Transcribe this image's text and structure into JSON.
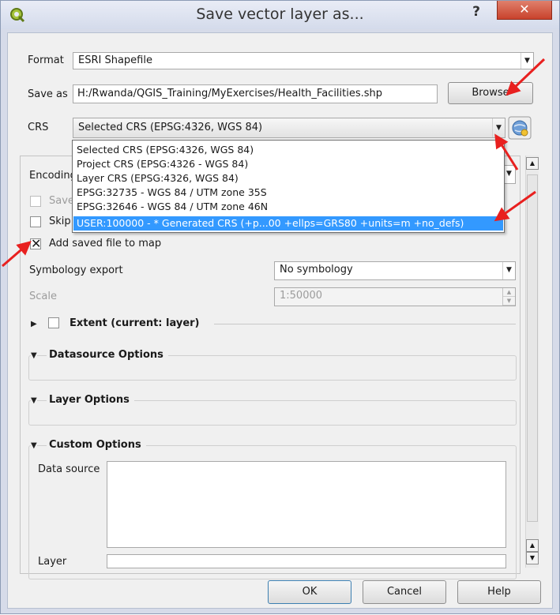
{
  "window": {
    "title": "Save vector layer as...",
    "help_label": "?",
    "close_label": "✕"
  },
  "form": {
    "format_label": "Format",
    "format_value": "ESRI Shapefile",
    "saveas_label": "Save as",
    "saveas_value": "H:/Rwanda/QGIS_Training/MyExercises/Health_Facilities.shp",
    "browse_label": "Browse",
    "crs_label": "CRS",
    "crs_value": "Selected CRS (EPSG:4326, WGS 84)"
  },
  "crs_options": [
    "Selected CRS (EPSG:4326, WGS 84)",
    "Project CRS (EPSG:4326 - WGS 84)",
    "Layer CRS (EPSG:4326, WGS 84)",
    "EPSG:32735 - WGS 84 / UTM zone 35S",
    "EPSG:32646 - WGS 84 / UTM zone 46N",
    "USER:100000 -  * Generated CRS (+p...00 +ellps=GRS80 +units=m +no_defs)"
  ],
  "options": {
    "encoding_label": "Encoding",
    "save_only_label": "Save",
    "skip_label": "Skip",
    "add_to_map_label": "Add saved file to map",
    "add_to_map_checked": true,
    "symbology_label": "Symbology export",
    "symbology_value": "No symbology",
    "scale_label": "Scale",
    "scale_value": "1:50000",
    "extent_label": "Extent (current: layer)",
    "datasource_label": "Datasource Options",
    "layer_options_label": "Layer Options",
    "custom_options_label": "Custom Options",
    "data_source_label": "Data source",
    "layer_label": "Layer"
  },
  "buttons": {
    "ok": "OK",
    "cancel": "Cancel",
    "help": "Help"
  },
  "colors": {
    "selection": "#3399ff",
    "annotation_arrow": "#e8201f",
    "close_button": "#c9422c"
  },
  "icons": [
    "qgis-logo-icon",
    "crs-globe-icon",
    "dropdown-arrow-icon",
    "expand-triangle-icon",
    "collapse-triangle-icon"
  ]
}
